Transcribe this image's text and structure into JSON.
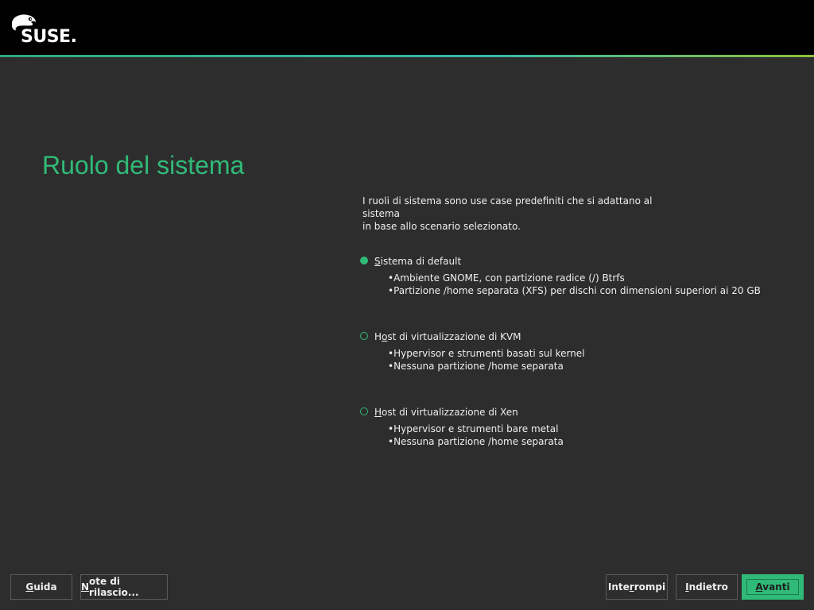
{
  "header": {
    "logo_text": "SUSE.",
    "accent_colors": [
      "#2fa87a",
      "#35b9ab",
      "#8fbf3a"
    ]
  },
  "page": {
    "title": "Ruolo del sistema",
    "intro_line1": "I ruoli di sistema sono use case predefiniti che si adattano al sistema",
    "intro_line2": "in base allo scenario selezionato."
  },
  "roles": [
    {
      "label_first": "S",
      "label_rest": "istema di default",
      "selected": true,
      "bullets": [
        "Ambiente GNOME, con partizione radice (/) Btrfs",
        "Partizione /home separata (XFS) per dischi con dimensioni superiori ai 20 GB"
      ]
    },
    {
      "label_first": "H",
      "label_mid": "o",
      "label_rest": "st di virtualizzazione di KVM",
      "selected": false,
      "bullets": [
        "Hypervisor e strumenti basati sul kernel",
        "Nessuna partizione /home separata"
      ]
    },
    {
      "label_first": "H",
      "label_rest": "ost di virtualizzazione di Xen",
      "selected": false,
      "bullets": [
        "Hypervisor e strumenti bare metal",
        "Nessuna partizione /home separata"
      ]
    }
  ],
  "buttons": {
    "help_u": "G",
    "help_rest": "uida",
    "notes_u": "N",
    "notes_rest": "ote di rilascio...",
    "abort_pre": "Inte",
    "abort_u": "r",
    "abort_rest": "rompi",
    "back_u": "I",
    "back_rest": "ndietro",
    "next_u": "A",
    "next_rest": "vanti"
  },
  "colors": {
    "accent": "#30ba78",
    "background": "#2d2d2d",
    "topbar": "#000000"
  }
}
